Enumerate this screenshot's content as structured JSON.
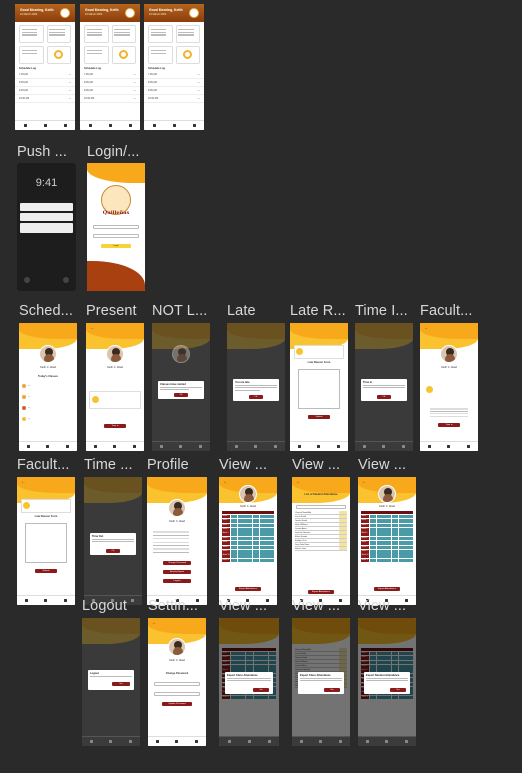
{
  "labels": {
    "push": "Push ...",
    "login": "Login/...",
    "schedule": "Sched...",
    "present": "Present",
    "not_late": "NOT L...",
    "late": "Late",
    "late_reason": "Late R...",
    "time_in": "Time I...",
    "faculty1": "Facult...",
    "faculty2": "Facult...",
    "time_out": "Time ...",
    "profile": "Profile",
    "view1": "View ...",
    "view2": "View ...",
    "view3": "View ...",
    "logout": "Logout",
    "settings": "Settin...",
    "view4": "View ...",
    "view5": "View ...",
    "view6": "View ..."
  },
  "dashboard": {
    "greeting": "Good Morning, Keith",
    "date": "10 March 2024",
    "section": "Schedule Log",
    "rows": [
      "7:00 AM",
      "8:00 AM",
      "9:00 AM",
      "10:00 AM",
      "11:00 AM"
    ]
  },
  "lock": {
    "time": "9:41"
  },
  "login": {
    "logo_text": "Quilleñas",
    "button": "Login"
  },
  "common": {
    "name": "Keith C. Abad",
    "sched_title": "Today's Classes",
    "submit": "Submit",
    "ok": "Ok",
    "yes": "Yes",
    "time_in": "Time in",
    "export": "Export Attendance"
  },
  "modals": {
    "not_late": "Classes have started",
    "late": "You are late",
    "time_in": "Time in",
    "time_out": "Time Out",
    "logout": "Logout",
    "export_class": "Export Class Attendance",
    "export_student": "Export Student Attendance"
  },
  "late_reason": {
    "title": "Late Reason Form"
  },
  "attendance": {
    "title": "List of Student Attendance",
    "weeks": [
      "Week 1",
      "Week 2",
      "Week 3",
      "Week 4",
      "Week 5",
      "Week 6",
      "Week 7",
      "Week 8",
      "Week 9",
      "Week 10",
      "Week 11"
    ],
    "students": [
      "Cheriah Navid Alo",
      "Lucas Smith",
      "Tamika Smith",
      "Nash Williams",
      "Lorena Ames",
      "Jasmine Gorman",
      "Ethan Sandin",
      "Kathlyn Cruz",
      "Jerry Dela Mora",
      "Ronnie Juan"
    ]
  },
  "profile": {
    "buttons": [
      "Change Password",
      "Activity Report",
      "Logout"
    ]
  },
  "settings": {
    "title": "Change Password",
    "button": "Update Password"
  },
  "colors": {
    "maroon": "#8b1a1a",
    "gold": "#f9c22e",
    "orange": "#f7a81b",
    "teal": "#4b9aa8"
  }
}
